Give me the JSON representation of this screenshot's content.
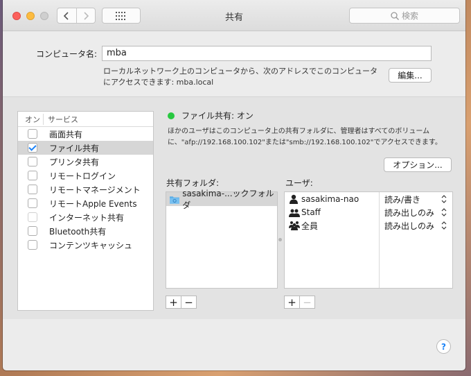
{
  "window": {
    "title": "共有",
    "search_placeholder": "検索"
  },
  "computer_name": {
    "label": "コンピュータ名:",
    "value": "mba",
    "description": "ローカルネットワーク上のコンピュータから、次のアドレスでこのコンピュータにアクセスできます: mba.local",
    "edit_button": "編集..."
  },
  "services": {
    "header_on": "オン",
    "header_service": "サービス",
    "items": [
      {
        "label": "画面共有",
        "checked": false
      },
      {
        "label": "ファイル共有",
        "checked": true
      },
      {
        "label": "プリンタ共有",
        "checked": false
      },
      {
        "label": "リモートログイン",
        "checked": false
      },
      {
        "label": "リモートマネージメント",
        "checked": false
      },
      {
        "label": "リモートApple Events",
        "checked": false
      },
      {
        "label": "インターネット共有",
        "checked": false
      },
      {
        "label": "Bluetooth共有",
        "checked": false
      },
      {
        "label": "コンテンツキャッシュ",
        "checked": false
      }
    ]
  },
  "status": {
    "text": "ファイル共有: オン",
    "description": "ほかのユーザはこのコンピュータ上の共有フォルダに、管理者はすべてのボリュームに、\"afp://192.168.100.102\"または\"smb://192.168.100.102\"でアクセスできます。",
    "options_button": "オプション..."
  },
  "shared_folders": {
    "label": "共有フォルダ:",
    "items": [
      "sasakima-...ックフォルダ"
    ]
  },
  "users": {
    "label": "ユーザ:",
    "items": [
      {
        "name": "sasakima-nao",
        "permission": "読み/書き",
        "icon": "single-user-icon"
      },
      {
        "name": "Staff",
        "permission": "読み出しのみ",
        "icon": "group-icon"
      },
      {
        "name": "全員",
        "permission": "読み出しのみ",
        "icon": "everyone-icon"
      }
    ]
  },
  "controls": {
    "add": "+",
    "remove": "−"
  },
  "help": "?"
}
